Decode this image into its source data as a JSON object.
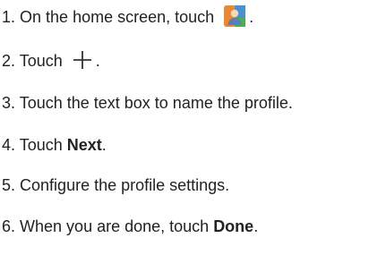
{
  "steps": [
    {
      "number": "1.",
      "text_before": "On the home screen, touch",
      "icon": "profile-app-icon",
      "text_after": "."
    },
    {
      "number": "2.",
      "text_before": "Touch",
      "icon": "plus-icon",
      "text_after": "."
    },
    {
      "number": "3.",
      "text": "Touch the text box to name the profile."
    },
    {
      "number": "4.",
      "text_before": "Touch",
      "bold": "Next",
      "text_after": "."
    },
    {
      "number": "5.",
      "text": "Configure the profile settings."
    },
    {
      "number": "6.",
      "text_before": "When you are done, touch",
      "bold": "Done",
      "text_after": "."
    }
  ],
  "colors": {
    "text": "#222222",
    "icon_orange": "#f0a040",
    "icon_blue": "#4a90d0",
    "icon_green": "#4caf50"
  }
}
